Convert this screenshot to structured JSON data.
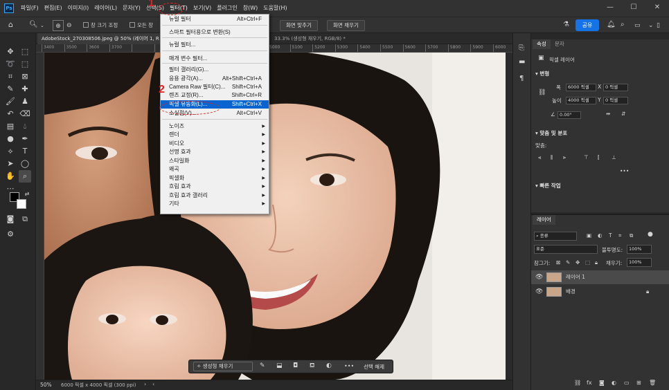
{
  "app": {
    "logo": "Ps"
  },
  "menubar": {
    "items": [
      "파일(F)",
      "편집(E)",
      "이미지(I)",
      "레이어(L)",
      "문자(Y)",
      "선택(S)",
      "필터(T)",
      "보기(V)",
      "플러그인",
      "창(W)",
      "도움말(H)"
    ],
    "window_controls": [
      "—",
      "☐",
      "✕"
    ]
  },
  "options_bar": {
    "resize_windows": "창 크기 조정",
    "all_windows": "모든 창",
    "fit_screen": "화면 맞추기",
    "fill_screen": "화면 채우기",
    "share": "공유"
  },
  "document": {
    "tab_title": "AdobeStock_270308506.jpeg @ 50% (레이어 1, R",
    "tab_title_2": "33.3% (생성형 채우기, RGB/8) *",
    "ruler_ticks": [
      "3400",
      "3500",
      "3600",
      "3700",
      "",
      "",
      "",
      "",
      "",
      "4900",
      "5000",
      "5100",
      "5200",
      "5300",
      "5400",
      "5500",
      "5600",
      "5700",
      "5800",
      "5900",
      "6000"
    ]
  },
  "filter_menu": {
    "items": [
      {
        "label": "뉴럴 필터",
        "shortcut": "Alt+Ctrl+F"
      },
      {
        "label": "스마트 필터용으로 변환(S)",
        "shortcut": ""
      },
      {
        "label": "뉴럴 필터...",
        "shortcut": ""
      },
      {
        "label": "매개 변수 필터...",
        "shortcut": ""
      },
      {
        "label": "필터 갤러리(G)...",
        "shortcut": ""
      },
      {
        "label": "응용 광각(A)...",
        "shortcut": "Alt+Shift+Ctrl+A"
      },
      {
        "label": "Camera Raw 필터(C)...",
        "shortcut": "Shift+Ctrl+A"
      },
      {
        "label": "렌즈 교정(R)...",
        "shortcut": "Shift+Ctrl+R"
      },
      {
        "label": "픽셀 유동화(L)...",
        "shortcut": "Shift+Ctrl+X"
      },
      {
        "label": "소실점(V)...",
        "shortcut": "Alt+Ctrl+V"
      },
      {
        "label": "노이즈",
        "shortcut": ""
      },
      {
        "label": "렌더",
        "shortcut": ""
      },
      {
        "label": "비디오",
        "shortcut": ""
      },
      {
        "label": "선명 효과",
        "shortcut": ""
      },
      {
        "label": "스타일화",
        "shortcut": ""
      },
      {
        "label": "왜곡",
        "shortcut": ""
      },
      {
        "label": "픽셀화",
        "shortcut": ""
      },
      {
        "label": "흐림 효과",
        "shortcut": ""
      },
      {
        "label": "흐림 효과 갤러리",
        "shortcut": ""
      },
      {
        "label": "기타",
        "shortcut": ""
      }
    ]
  },
  "annotations": {
    "step1": "1",
    "step2": "2"
  },
  "properties": {
    "tabs": [
      "속성",
      "문자"
    ],
    "layer_type": "픽셀 레이어",
    "transform_title": "변형",
    "w_label": "폭",
    "w_value": "6000 픽셀",
    "x_label": "X",
    "x_value": "0 픽셀",
    "h_label": "높이",
    "h_value": "4000 픽셀",
    "y_label": "Y",
    "y_value": "0 픽셀",
    "angle_value": "0.00°",
    "align_title": "맞춤 및 분포",
    "align_label": "맞춤:",
    "quick_title": "빠른 작업",
    "more": "•••"
  },
  "layers": {
    "tab": "레이어",
    "filter_kind": "종류",
    "blend_mode": "표준",
    "opacity_label": "불투명도:",
    "opacity_value": "100%",
    "lock_label": "잠그기:",
    "fill_label": "채우기:",
    "fill_value": "100%",
    "rows": [
      {
        "name": "레이어 1",
        "selected": true
      },
      {
        "name": "배경",
        "selected": false
      }
    ]
  },
  "statusbar": {
    "zoom": "50%",
    "info": "6000 픽셀 x 4000 픽셀 (300 ppi)"
  },
  "contextual_bar": {
    "generative_fill": "생성형 채우기",
    "deselect": "선택 해제",
    "more": "•••"
  }
}
